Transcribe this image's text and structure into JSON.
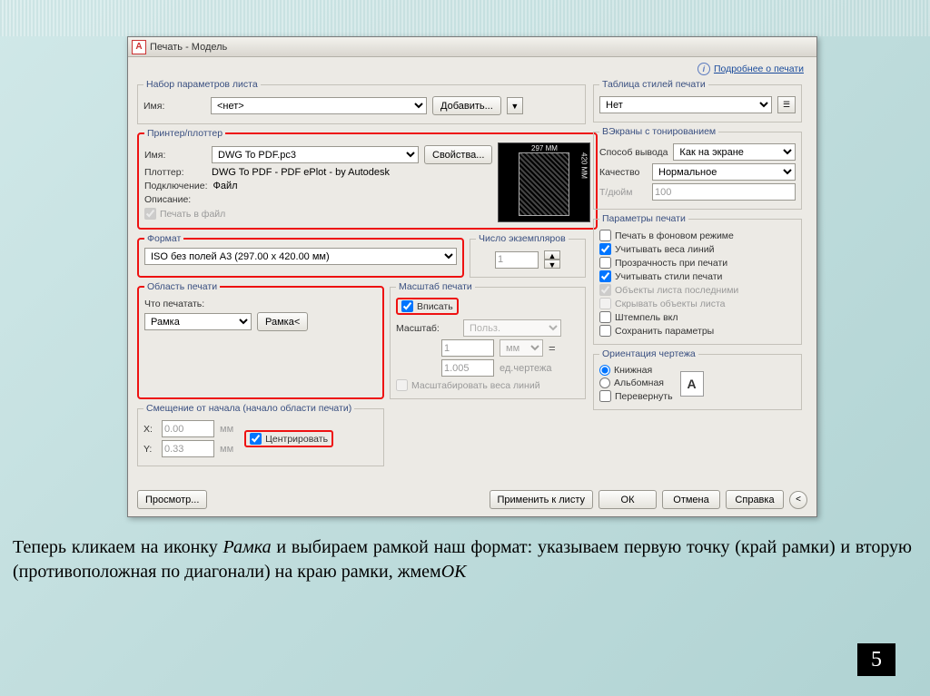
{
  "dialog": {
    "title": "Печать - Модель",
    "info_link": "Подробнее о печати"
  },
  "pageset": {
    "legend": "Набор параметров листа",
    "name_label": "Имя:",
    "name_value": "<нет>",
    "add_btn": "Добавить..."
  },
  "printer": {
    "legend": "Принтер/плоттер",
    "name_label": "Имя:",
    "name_value": "DWG To PDF.pc3",
    "props_btn": "Свойства...",
    "plotter_label": "Плоттер:",
    "plotter_value": "DWG To PDF - PDF ePlot - by Autodesk",
    "conn_label": "Подключение:",
    "conn_value": "Файл",
    "desc_label": "Описание:",
    "tofile": "Печать в файл",
    "preview_w": "297 MM",
    "preview_h": "420 MM"
  },
  "paper": {
    "legend": "Формат",
    "value": "ISO без полей A3 (297.00 x 420.00 мм)"
  },
  "copies": {
    "legend": "Число экземпляров",
    "value": "1"
  },
  "area": {
    "legend": "Область печати",
    "what_label": "Что печатать:",
    "value": "Рамка",
    "window_btn": "Рамка<"
  },
  "scale": {
    "legend": "Масштаб печати",
    "fit": "Вписать",
    "scale_label": "Масштаб:",
    "scale_value": "Польз.",
    "num_value": "1",
    "unit_value": "мм",
    "unit2_value": "1.005",
    "unit2_label": "ед.чертежа",
    "lineweights": "Масштабировать веса линий"
  },
  "offset": {
    "legend": "Смещение от начала (начало области печати)",
    "x_label": "X:",
    "x_value": "0.00",
    "y_label": "Y:",
    "y_value": "0.33",
    "unit": "мм",
    "center": "Центрировать"
  },
  "styles": {
    "legend": "Таблица стилей печати",
    "value": "Нет"
  },
  "shaded": {
    "legend": "ВЭкраны с тонированием",
    "mode_label": "Способ вывода",
    "mode_value": "Как на экране",
    "quality_label": "Качество",
    "quality_value": "Нормальное",
    "dpi_label": "Т/дюйм",
    "dpi_value": "100"
  },
  "options": {
    "legend": "Параметры печати",
    "o1": "Печать в фоновом режиме",
    "o2": "Учитывать веса линий",
    "o3": "Прозрачность при печати",
    "o4": "Учитывать стили печати",
    "o5": "Объекты листа последними",
    "o6": "Скрывать объекты листа",
    "o7": "Штемпель вкл",
    "o8": "Сохранить параметры"
  },
  "orient": {
    "legend": "Ориентация чертежа",
    "portrait": "Книжная",
    "landscape": "Альбомная",
    "upside": "Перевернуть"
  },
  "buttons": {
    "preview": "Просмотр...",
    "apply": "Применить к листу",
    "ok": "ОК",
    "cancel": "Отмена",
    "help": "Справка"
  },
  "text_below": {
    "t1": "Теперь кликаем на иконку ",
    "t2": "Рамка",
    "t3": " и выбираем рамкой наш формат: указываем первую точку (край рамки) и вторую (противоположная по диагонали) на краю рамки, жмем",
    "t4": "ОК"
  },
  "page_number": "5"
}
